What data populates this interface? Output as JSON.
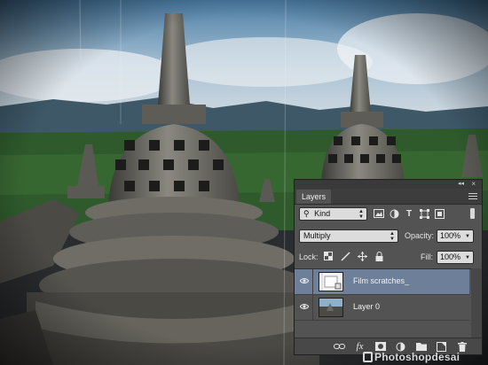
{
  "panel": {
    "tab_title": "Layers",
    "collapse_glyph": "◂◂",
    "close_glyph": "×",
    "filter": {
      "kind_label": "Kind",
      "search_glyph": "⚲"
    },
    "filter_icons": [
      "image-filter-icon",
      "adjustment-filter-icon",
      "type-filter-icon",
      "shape-filter-icon",
      "smart-object-filter-icon"
    ],
    "blend": {
      "mode": "Multiply",
      "opacity_label": "Opacity:",
      "opacity_value": "100%"
    },
    "lock": {
      "label": "Lock:",
      "fill_label": "Fill:",
      "fill_value": "100%"
    },
    "layers": [
      {
        "name": "Film scratches_",
        "selected": true,
        "visible": true
      },
      {
        "name": "Layer 0",
        "selected": false,
        "visible": true
      }
    ],
    "footer_icons": [
      "link-layers-icon",
      "fx-icon",
      "add-mask-icon",
      "adjustment-layer-icon",
      "new-group-icon",
      "new-layer-icon",
      "delete-layer-icon"
    ],
    "colors": {
      "panel_bg": "#535353",
      "selected_row": "#6d7f99",
      "tab_bar": "#3d3d3d"
    }
  },
  "watermark": {
    "text": "Photoshopdesai"
  }
}
